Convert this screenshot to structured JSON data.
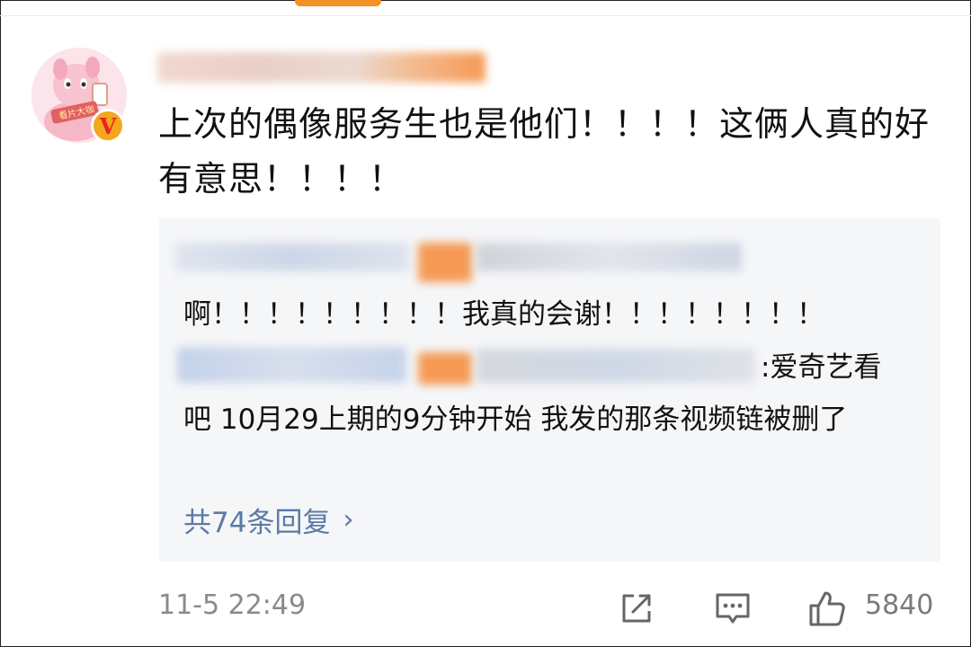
{
  "post": {
    "comment_text": "上次的偶像服务生也是他们！！！！这俩人真的好有意思！！！！",
    "timestamp": "11-5 22:49",
    "like_count": "5840",
    "verified_badge": "V"
  },
  "replies": {
    "reply1_text": "啊！！！！！！！！！我真的会谢！！！！！！！！",
    "reply2_text_head": ":爱奇艺看",
    "reply2_text_tail": "吧 10月29上期的9分钟开始 我发的那条视频链被删了",
    "more_label": "共74条回复",
    "more_chevron": "›"
  },
  "icons": {
    "forward": "share-icon",
    "comment": "comment-icon",
    "like": "thumbs-up-icon"
  },
  "colors": {
    "accent": "#f29222",
    "link": "#5b7aa6",
    "reply_bg": "#f5f6f8"
  }
}
